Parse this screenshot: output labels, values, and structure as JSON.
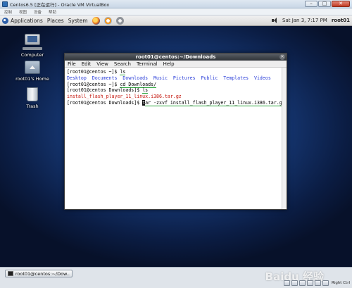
{
  "vbox": {
    "title": "Centos6.5 [正在运行] - Oracle VM VirtualBox",
    "menu": [
      "控制",
      "视图",
      "设备",
      "帮助"
    ]
  },
  "panel": {
    "applications": "Applications",
    "places": "Places",
    "system": "System",
    "clock": "Sat Jan  3,  7:17 PM",
    "user": "root01"
  },
  "desktop": {
    "computer": "Computer",
    "home": "root01's Home",
    "trash": "Trash"
  },
  "terminal": {
    "title": "root01@centos:~/Downloads",
    "menu": [
      "File",
      "Edit",
      "View",
      "Search",
      "Terminal",
      "Help"
    ],
    "lines": {
      "l1_prompt": "[root01@centos ~]$ ",
      "l1_cmd": "ls",
      "l2_dirs": "Desktop  Documents  Downloads  Music  Pictures  Public  Templates  Videos",
      "l3_prompt": "[root01@centos ~]$ ",
      "l3_cmd": "cd Downloads/",
      "l4_prompt": "[root01@centos Downloads]$ ",
      "l4_cmd": "ls",
      "l5_file": "install_flash_player_11_linux.i386.tar.gz",
      "l6_prompt": "[root01@centos Downloads]$ ",
      "l6_cursor": "t",
      "l6_cmd": "ar -zxvf install_flash_player_11_linux.i386.tar.gz"
    }
  },
  "taskbar": {
    "window_label": "root01@centos:~/Dow..."
  },
  "status": {
    "host_key": "Right Ctrl"
  },
  "watermark": "Baidu 经验"
}
